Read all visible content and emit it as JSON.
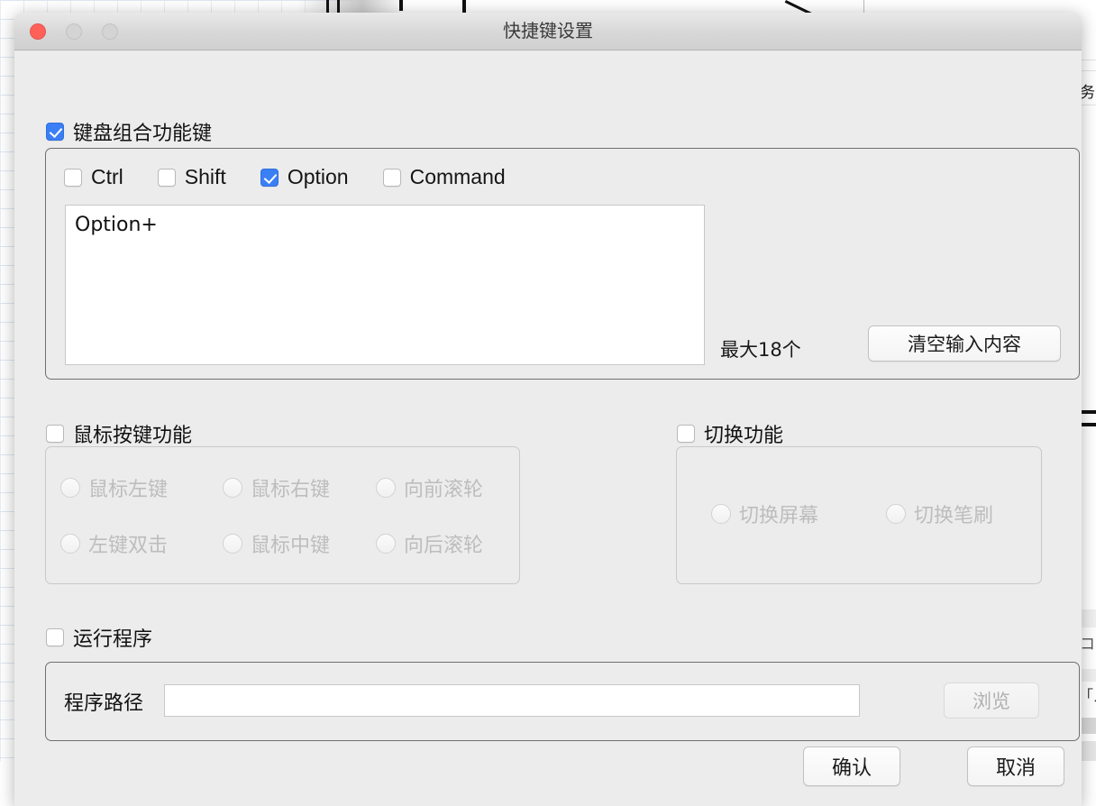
{
  "window": {
    "title": "快捷键设置",
    "traffic_lights": [
      "close",
      "minimize",
      "zoom"
    ],
    "accent_checkbox_color": "#3b7ff5",
    "close_button_color": "#ff6159",
    "titlebar_color": "#d8d8d8",
    "body_color": "#ececec"
  },
  "keyboard_section": {
    "enabled": true,
    "title": "键盘组合功能键",
    "modifiers": [
      {
        "label": "Ctrl",
        "checked": false
      },
      {
        "label": "Shift",
        "checked": false
      },
      {
        "label": "Option",
        "checked": true
      },
      {
        "label": "Command",
        "checked": false
      }
    ],
    "combo_value": "Option+",
    "combo_placeholder": "",
    "max_count_label": "最大18个",
    "clear_button": "清空输入内容"
  },
  "mouse_section": {
    "enabled": false,
    "title": "鼠标按键功能",
    "options": [
      {
        "label": "鼠标左键",
        "selected": false
      },
      {
        "label": "鼠标右键",
        "selected": false
      },
      {
        "label": "向前滚轮",
        "selected": false
      },
      {
        "label": "左键双击",
        "selected": false
      },
      {
        "label": "鼠标中键",
        "selected": false
      },
      {
        "label": "向后滚轮",
        "selected": false
      }
    ]
  },
  "switch_section": {
    "enabled": false,
    "title": "切换功能",
    "options": [
      {
        "label": "切换屏幕",
        "selected": false
      },
      {
        "label": "切换笔刷",
        "selected": false
      }
    ]
  },
  "run_section": {
    "enabled": false,
    "title": "运行程序",
    "path_label": "程序路径",
    "path_value": "",
    "path_placeholder": "",
    "browse_button": "浏览",
    "browse_disabled": true
  },
  "footer": {
    "confirm_label": "确认",
    "cancel_label": "取消"
  },
  "background": {
    "visible_char_right": "务",
    "char_bottom_1": "コ",
    "char_bottom_2": "「ル"
  }
}
